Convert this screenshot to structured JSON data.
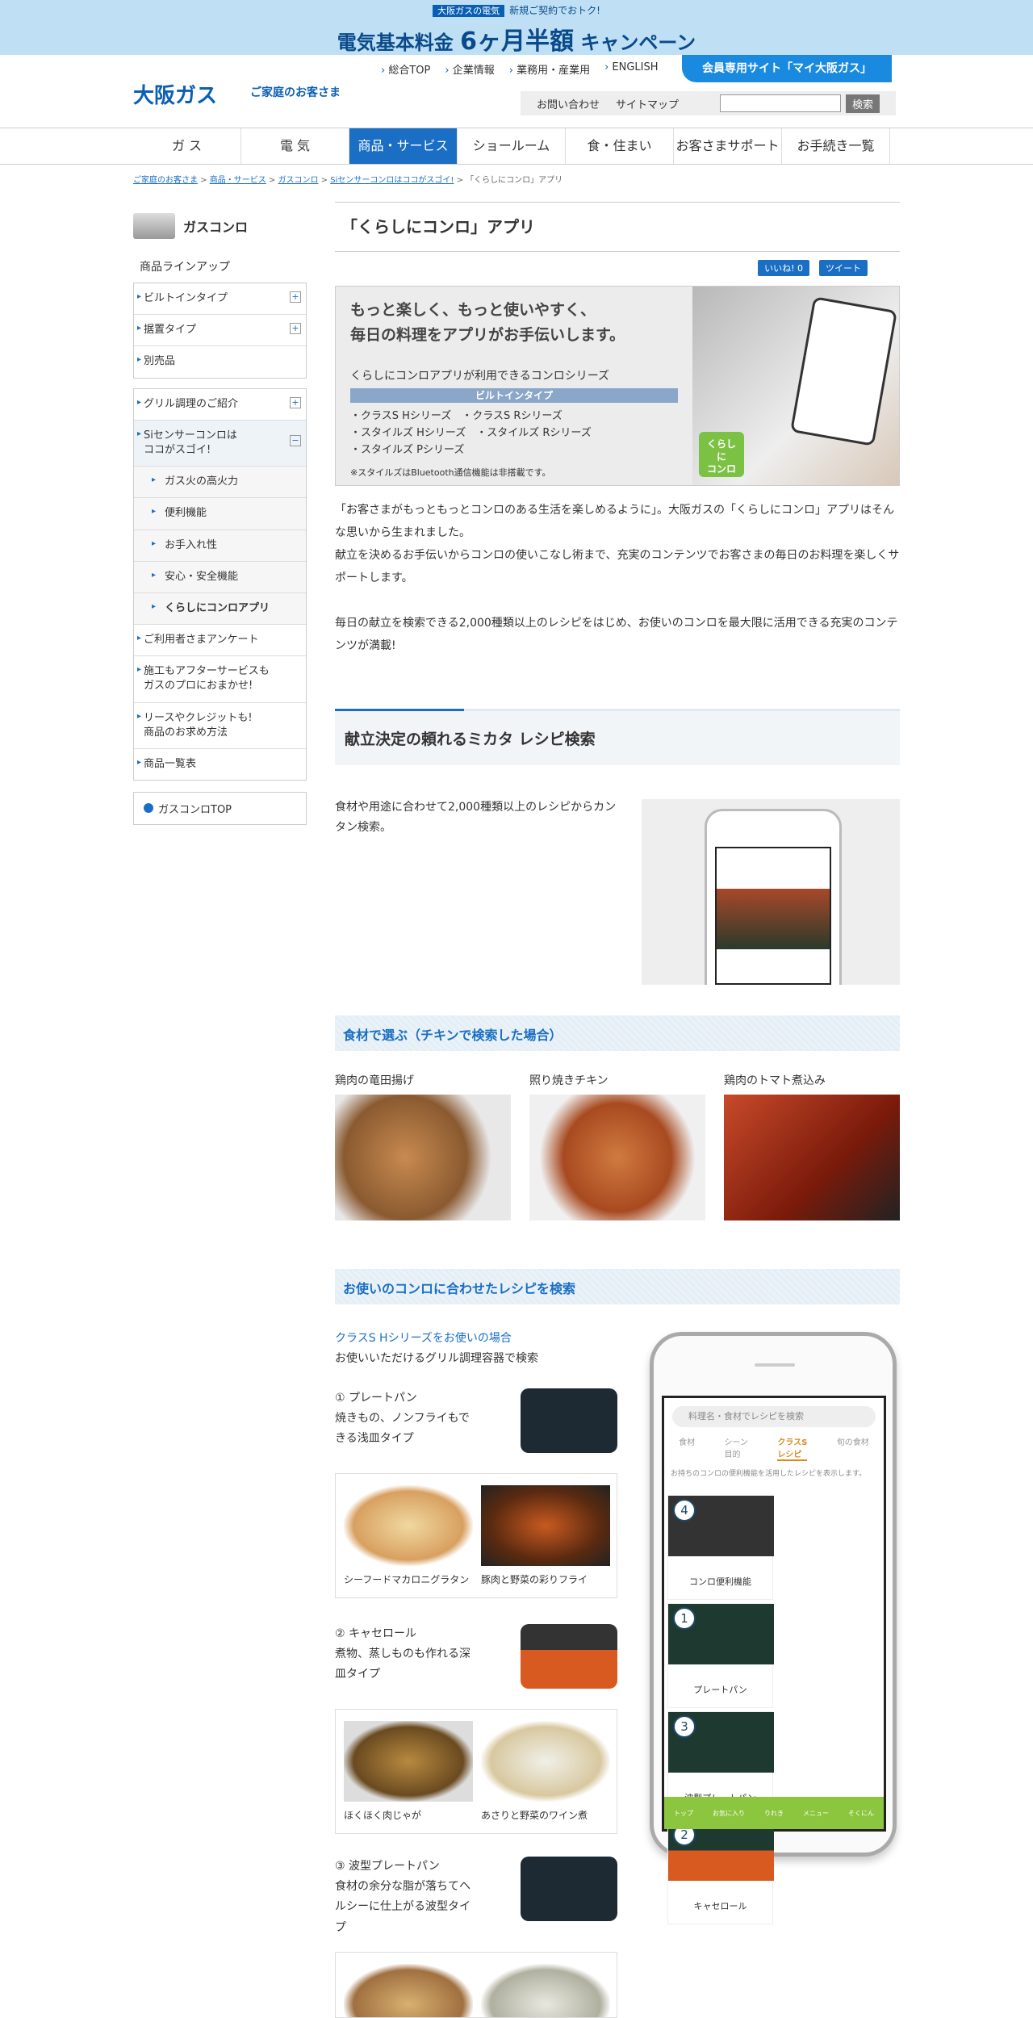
{
  "banner": {
    "tag": "大阪ガスの電気",
    "line1": "新規ご契約でおトク!",
    "line2a": "電気基本料金 ",
    "line2b": "6ヶ月半額",
    "line2c": " キャンペーン"
  },
  "header": {
    "logo": "大阪ガス",
    "logo_sub": "ご家庭のお客さま",
    "util": [
      "総合TOP",
      "企業情報",
      "業務用・産業用",
      "ENGLISH"
    ],
    "member": "会員専用サイト「マイ大阪ガス」",
    "contact": "お問い合わせ",
    "sitemap": "サイトマップ",
    "search_btn": "検索"
  },
  "gnav": [
    "ガ ス",
    "電 気",
    "商品・サービス",
    "ショールーム",
    "食・住まい",
    "お客さまサポート",
    "お手続き一覧"
  ],
  "breadcrumb": {
    "links": [
      "ご家庭のお客さま",
      "商品・サービス",
      "ガスコンロ",
      "Siセンサーコンロはココがスゴイ!"
    ],
    "current": "「くらしにコンロ」アプリ"
  },
  "side": {
    "title": "ガスコンロ",
    "lineup": "商品ラインアップ",
    "box1": [
      "ビルトインタイプ",
      "据置タイプ",
      "別売品"
    ],
    "grill": "グリル調理のご紹介",
    "si": "Siセンサーコンロは\nココがスゴイ!",
    "si_subs": [
      "ガス火の高火力",
      "便利機能",
      "お手入れ性",
      "安心・安全機能",
      "くらしにコンロアプリ"
    ],
    "box3": [
      "ご利用者さまアンケート",
      "施工もアフターサービスも\nガスのプロにおまかせ!",
      "リースやクレジットも!\n商品のお求め方法",
      "商品一覧表"
    ],
    "top": "ガスコンロTOP"
  },
  "main": {
    "title": "「くらしにコンロ」アプリ",
    "like": "いいね! 0",
    "tweet": "ツイート",
    "hero": {
      "t1": "もっと楽しく、もっと使いやすく、\n毎日の料理をアプリがお手伝いします。",
      "t2": "くらしにコンロアプリが利用できるコンロシリーズ",
      "bar": "ビルトインタイプ",
      "series": "・クラスS Hシリーズ　・クラスS Rシリーズ\n・スタイルズ Hシリーズ　・スタイルズ Rシリーズ\n・スタイルズ Pシリーズ",
      "note": "※スタイルズはBluetooth通信機能は非搭載です。",
      "badge": "くらし\nに\nコンロ"
    },
    "intro": "「お客さまがもっともっとコンロのある生活を楽しめるように」。大阪ガスの「くらしにコンロ」アプリはそんな思いから生まれました。\n献立を決めるお手伝いからコンロの使いこなし術まで、充実のコンテンツでお客さまの毎日のお料理を楽しくサポートします。\n\n毎日の献立を検索できる2,000種類以上のレシピをはじめ、お使いのコンロを最大限に活用できる充実のコンテンツが満載!",
    "sec1": "献立決定の頼れるミカタ レシピ検索",
    "sec1_text": "食材や用途に合わせて2,000種類以上のレシピからカンタン検索。",
    "sub1": "食材で選ぶ（チキンで検索した場合）",
    "recipes": [
      "鶏肉の竜田揚げ",
      "照り焼きチキン",
      "鶏肉のトマト煮込み"
    ],
    "sub2": "お使いのコンロに合わせたレシピを検索",
    "class_title": "クラスS Hシリーズをお使いの場合",
    "class_sub": "お使いいただけるグリル調理容器で検索",
    "pans": [
      {
        "t": "① プレートパン",
        "d": "焼きもの、ノンフライもできる浅皿タイプ",
        "photos": [
          "シーフードマカロニグラタン",
          "豚肉と野菜の彩りフライ"
        ]
      },
      {
        "t": "② キャセロール",
        "d": "煮物、蒸しものも作れる深皿タイプ",
        "photos": [
          "ほくほく肉じゃが",
          "あさりと野菜のワイン煮"
        ]
      },
      {
        "t": "③ 波型プレートパン",
        "d": "食材の余分な脂が落ちてヘルシーに仕上がる波型タイプ"
      }
    ],
    "phone": {
      "search": "料理名・食材でレシピを検索",
      "tabs": [
        "食材",
        "シーン\n目的",
        "クラスS\nレシピ",
        "旬の食材"
      ],
      "desc": "お持ちのコンロの便利機能を活用したレシピを表示します。",
      "cells": [
        {
          "n": "4",
          "l": "コンロ便利機能"
        },
        {
          "n": "1",
          "l": "プレートパン"
        },
        {
          "n": "3",
          "l": "波型プレートパン"
        },
        {
          "n": "2",
          "l": "キャセロール"
        }
      ],
      "foot": [
        "トップ",
        "お気に入り",
        "りれき",
        "メニュー",
        "そくにん"
      ]
    }
  }
}
